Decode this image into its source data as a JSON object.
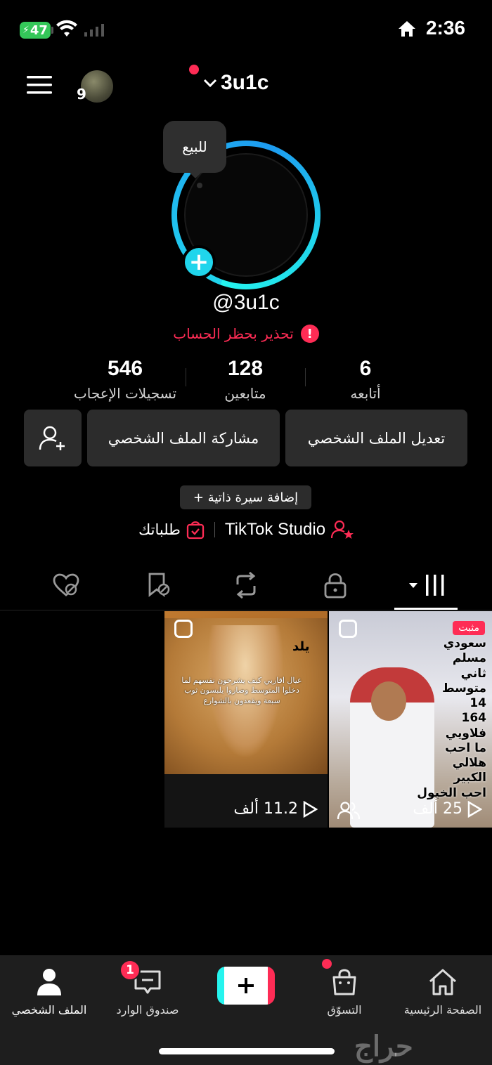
{
  "status_bar": {
    "battery": "47",
    "time": "2:36"
  },
  "header": {
    "avatar_count": "9",
    "username": "3u1c"
  },
  "profile": {
    "bubble_text": "للبيع",
    "handle": "@3u1c",
    "warning": "تحذير بحظر الحساب",
    "stats": [
      {
        "value": "546",
        "label": "تسجيلات الإعجاب"
      },
      {
        "value": "128",
        "label": "متابعين"
      },
      {
        "value": "6",
        "label": "أتابعه"
      }
    ],
    "buttons": {
      "edit": "تعديل الملف الشخصي",
      "share": "مشاركة الملف الشخصي"
    },
    "add_bio": "+ إضافة سيرة ذاتية",
    "studio": "TikTok Studio",
    "orders": "طلباتك"
  },
  "videos": [
    {
      "views": "11.2 ألف",
      "word": "يلد",
      "caption": "عيال اقاربي كيف يشرحون نفسهم لما دخلوا المتوسط وصاروا يلبسون ثوب سبعة ويقعدون بالشوارع"
    },
    {
      "views": "25 ألف",
      "pinned": "مثبت",
      "lines": [
        "سعودي",
        "مسلم",
        "ثاني متوسط",
        "14",
        "164",
        "فلاويي",
        "ما احب",
        "هلالي",
        "الكبير",
        "احب الخيول"
      ]
    }
  ],
  "nav": {
    "home": "الصفحة الرئيسية",
    "shop": "التسوّق",
    "inbox": "صندوق الوارد",
    "inbox_badge": "1",
    "profile": "الملف الشخصي"
  },
  "watermark": "حراج",
  "colors": {
    "accent": "#fe2c55",
    "cyan": "#20d5ec",
    "surface": "#2c2c2c"
  }
}
